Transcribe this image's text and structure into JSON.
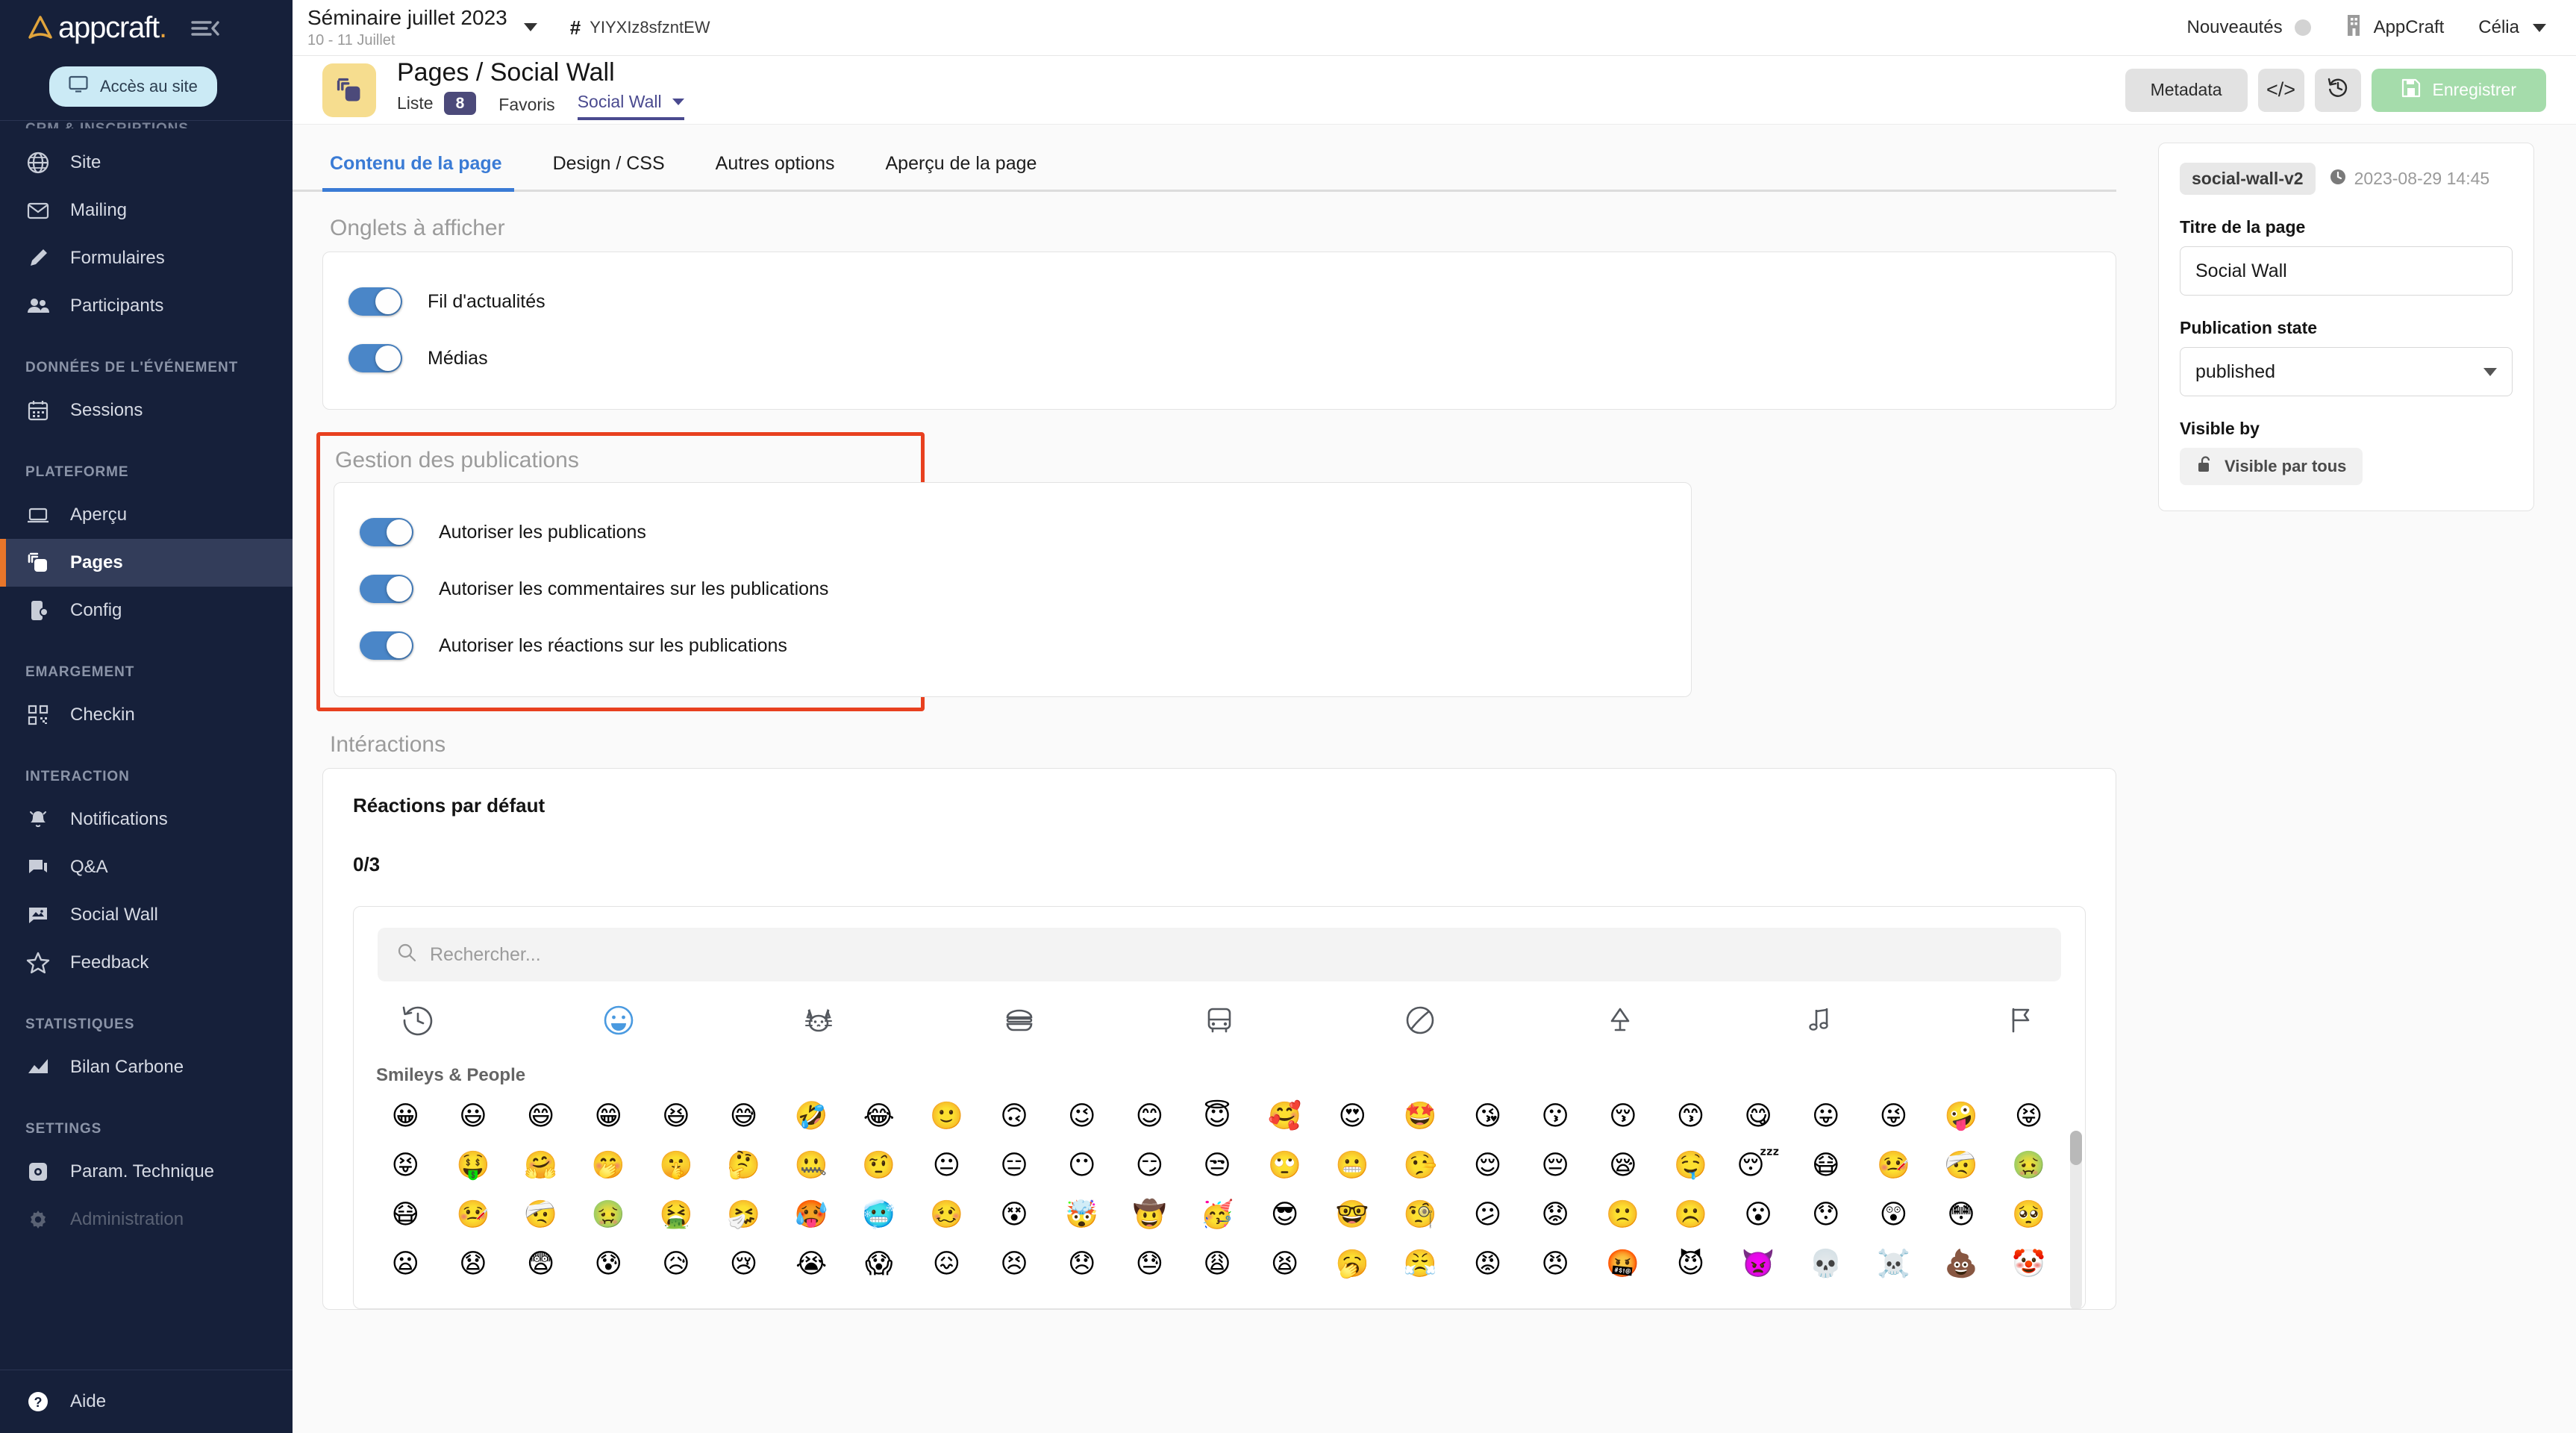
{
  "brand": {
    "name": "appcraft",
    "dot": "."
  },
  "sidebar": {
    "access_button": "Accès au site",
    "clipped_section": "CRM & INSCRIPTIONS",
    "sections": [
      {
        "label": "",
        "items": [
          {
            "label": "Site",
            "icon": "globe-icon"
          },
          {
            "label": "Mailing",
            "icon": "envelope-icon"
          },
          {
            "label": "Formulaires",
            "icon": "pencil-icon"
          },
          {
            "label": "Participants",
            "icon": "people-icon"
          }
        ]
      },
      {
        "label": "DONNÉES DE L'ÉVÉNEMENT",
        "items": [
          {
            "label": "Sessions",
            "icon": "calendar-icon"
          }
        ]
      },
      {
        "label": "PLATEFORME",
        "items": [
          {
            "label": "Aperçu",
            "icon": "laptop-icon"
          },
          {
            "label": "Pages",
            "icon": "pages-icon",
            "active": true
          },
          {
            "label": "Config",
            "icon": "device-config-icon"
          }
        ]
      },
      {
        "label": "EMARGEMENT",
        "items": [
          {
            "label": "Checkin",
            "icon": "qrcode-icon"
          }
        ]
      },
      {
        "label": "INTERACTION",
        "items": [
          {
            "label": "Notifications",
            "icon": "bell-icon"
          },
          {
            "label": "Q&A",
            "icon": "chat-icon"
          },
          {
            "label": "Social Wall",
            "icon": "image-chat-icon"
          },
          {
            "label": "Feedback",
            "icon": "star-icon"
          }
        ]
      },
      {
        "label": "STATISTIQUES",
        "items": [
          {
            "label": "Bilan Carbone",
            "icon": "chart-icon"
          }
        ]
      },
      {
        "label": "SETTINGS",
        "items": [
          {
            "label": "Param. Technique",
            "icon": "settings-square-icon"
          },
          {
            "label": "Administration",
            "icon": "gear-icon",
            "disabled": true
          }
        ]
      }
    ],
    "help": {
      "label": "Aide",
      "icon": "question-icon"
    }
  },
  "topbar": {
    "event_title": "Séminaire juillet 2023",
    "event_dates": "10 - 11 Juillet",
    "event_code": "YIYXIz8sfzntEW",
    "news_label": "Nouveautés",
    "org_label": "AppCraft",
    "user_label": "Célia"
  },
  "pagehead": {
    "title": "Pages / Social Wall",
    "tabs": [
      {
        "label": "Liste",
        "badge": "8"
      },
      {
        "label": "Favoris"
      },
      {
        "label": "Social Wall",
        "selected": true,
        "has_caret": true
      }
    ],
    "actions": {
      "metadata": "Metadata",
      "code_icon": "</>",
      "history_icon": "history-icon",
      "save": "Enregistrer"
    }
  },
  "content": {
    "tabs": [
      {
        "label": "Contenu de la page",
        "selected": true
      },
      {
        "label": "Design / CSS"
      },
      {
        "label": "Autres options"
      },
      {
        "label": "Aperçu de la page"
      }
    ],
    "section_tabs": {
      "title": "Onglets à afficher",
      "toggles": [
        {
          "label": "Fil d'actualités",
          "on": true
        },
        {
          "label": "Médias",
          "on": true
        }
      ]
    },
    "section_publications": {
      "title": "Gestion des publications",
      "highlight_color": "#e8401f",
      "toggles": [
        {
          "label": "Autoriser les publications",
          "on": true
        },
        {
          "label": "Autoriser les commentaires sur les publications",
          "on": true
        },
        {
          "label": "Autoriser les réactions sur les publications",
          "on": true
        }
      ]
    },
    "section_interactions": {
      "title": "Intéractions",
      "sub_title": "Réactions par défaut",
      "count": "0/3",
      "picker": {
        "search_placeholder": "Rechercher...",
        "categories": [
          {
            "name": "recent-clock-icon",
            "selected": false
          },
          {
            "name": "smiley-icon",
            "selected": true
          },
          {
            "name": "cat-icon",
            "selected": false
          },
          {
            "name": "burger-icon",
            "selected": false
          },
          {
            "name": "bus-icon",
            "selected": false
          },
          {
            "name": "ball-icon",
            "selected": false
          },
          {
            "name": "lamp-icon",
            "selected": false
          },
          {
            "name": "music-icon",
            "selected": false
          },
          {
            "name": "flag-icon",
            "selected": false
          }
        ],
        "group_title": "Smileys & People",
        "rows": [
          [
            "😀",
            "😃",
            "😄",
            "😁",
            "😆",
            "😅",
            "🤣",
            "😂",
            "🙂",
            "🙃",
            "😉",
            "😊",
            "😇",
            "🥰",
            "😍",
            "🤩",
            "😘",
            "😗",
            "😚",
            "😙",
            "😋",
            "😛",
            "😜",
            "🤪",
            "😝"
          ],
          [
            "😝",
            "🤑",
            "🤗",
            "🤭",
            "🤫",
            "🤔",
            "🤐",
            "🤨",
            "😐",
            "😑",
            "😶",
            "😏",
            "😒",
            "🙄",
            "😬",
            "🤥",
            "😌",
            "😔",
            "😪",
            "🤤",
            "😴",
            "😷",
            "🤒",
            "🤕",
            "🤢"
          ],
          [
            "😷",
            "🤒",
            "🤕",
            "🤢",
            "🤮",
            "🤧",
            "🥵",
            "🥶",
            "🥴",
            "😵",
            "🤯",
            "🤠",
            "🥳",
            "😎",
            "🤓",
            "🧐",
            "😕",
            "😟",
            "🙁",
            "☹️",
            "😮",
            "😯",
            "😲",
            "😳",
            "🥺"
          ],
          [
            "😦",
            "😧",
            "😨",
            "😰",
            "😥",
            "😢",
            "😭",
            "😱",
            "😖",
            "😣",
            "😞",
            "😓",
            "😩",
            "😫",
            "🥱",
            "😤",
            "😡",
            "😠",
            "🤬",
            "😈",
            "👿",
            "💀",
            "☠️",
            "💩",
            "🤡"
          ]
        ]
      }
    }
  },
  "rail": {
    "chip": "social-wall-v2",
    "timestamp": "2023-08-29 14:45",
    "title_label": "Titre de la page",
    "title_value": "Social Wall",
    "state_label": "Publication state",
    "state_value": "published",
    "visible_label": "Visible by",
    "visible_value": "Visible par tous"
  }
}
